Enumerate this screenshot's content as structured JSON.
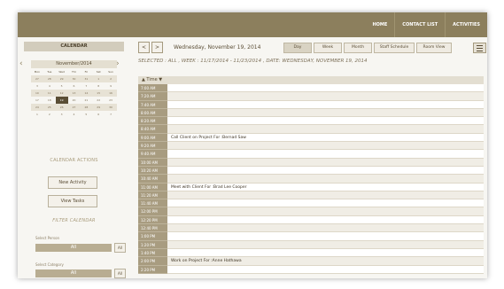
{
  "top_nav": [
    "HOME",
    "CONTACT LIST",
    "ACTIVITIES"
  ],
  "sidebar": {
    "heading": "CALENDAR",
    "mini_calendar": {
      "month_label": "November/2014",
      "weekdays": [
        "Mon",
        "Tue",
        "Wed",
        "Thr",
        "Fri",
        "Sat",
        "Sun"
      ],
      "weeks": [
        [
          "27",
          "28",
          "29",
          "30",
          "31",
          "1",
          "2"
        ],
        [
          "3",
          "4",
          "5",
          "6",
          "7",
          "8",
          "9"
        ],
        [
          "10",
          "11",
          "12",
          "13",
          "14",
          "15",
          "16"
        ],
        [
          "17",
          "18",
          "19",
          "20",
          "21",
          "22",
          "23"
        ],
        [
          "24",
          "25",
          "26",
          "27",
          "28",
          "29",
          "30"
        ],
        [
          "1",
          "2",
          "3",
          "4",
          "5",
          "6",
          "7"
        ]
      ],
      "selected_day": "19"
    },
    "calendar_actions_label": "CALENDAR ACTIONS",
    "new_activity_label": "New Activity",
    "view_tasks_label": "View Tasks",
    "filter_label": "FILTER CALENDAR",
    "select_person_label": "Select Person",
    "select_person_value": "All",
    "select_person_btn": "All",
    "select_category_label": "Select Category",
    "select_category_value": "All",
    "select_category_btn": "All"
  },
  "header": {
    "prev": "<",
    "next": ">",
    "date_title": "Wednesday, November 19, 2014",
    "views": [
      "Day",
      "Week",
      "Month",
      "Staff Schedule",
      "Room View"
    ],
    "active_view": "Day"
  },
  "selected_line": "SELECTED : ALL ,  WEEK :  11/17/2014 - 11/23/2014 ,  DATE:  WEDNESDAY, NOVEMBER 19, 2014",
  "grid": {
    "time_header": "▲ Time ▼",
    "rows": [
      {
        "time": "7:00 AM",
        "event": ""
      },
      {
        "time": "7:20 AM",
        "event": ""
      },
      {
        "time": "7:40 AM",
        "event": ""
      },
      {
        "time": "8:00 AM",
        "event": ""
      },
      {
        "time": "8:20 AM",
        "event": ""
      },
      {
        "time": "8:40 AM",
        "event": ""
      },
      {
        "time": "9:00 AM",
        "event": "Call Client on Project  For :Bernad Saw"
      },
      {
        "time": "9:20 AM",
        "event": ""
      },
      {
        "time": "9:40 AM",
        "event": ""
      },
      {
        "time": "10:00 AM",
        "event": ""
      },
      {
        "time": "10:20 AM",
        "event": ""
      },
      {
        "time": "10:40 AM",
        "event": ""
      },
      {
        "time": "11:00 AM",
        "event": "Meet with Client  For :Brad Lee Cooper"
      },
      {
        "time": "11:20 AM",
        "event": ""
      },
      {
        "time": "11:40 AM",
        "event": ""
      },
      {
        "time": "12:00 PM",
        "event": ""
      },
      {
        "time": "12:20 PM",
        "event": ""
      },
      {
        "time": "12:40 PM",
        "event": ""
      },
      {
        "time": "1:00 PM",
        "event": ""
      },
      {
        "time": "1:20 PM",
        "event": ""
      },
      {
        "time": "1:40 PM",
        "event": ""
      },
      {
        "time": "2:00 PM",
        "event": "Work on Project  For :Anne Hathawa"
      },
      {
        "time": "2:20 PM",
        "event": ""
      }
    ]
  }
}
